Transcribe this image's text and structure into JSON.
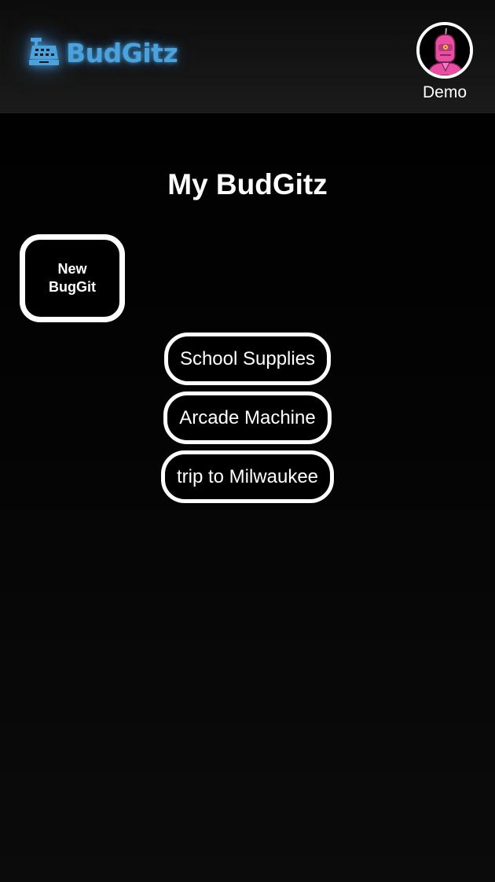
{
  "header": {
    "logo_text": "BudGitz",
    "logo_icon": "cash-register-icon",
    "accent_color": "#4aa3dd",
    "user": {
      "name": "Demo",
      "avatar_icon": "robot-avatar"
    }
  },
  "main": {
    "title": "My BudGitz",
    "new_button_label": "New BugGit",
    "budgets": [
      {
        "name": "School Supplies"
      },
      {
        "name": "Arcade Machine"
      },
      {
        "name": "trip to Milwaukee"
      }
    ]
  }
}
